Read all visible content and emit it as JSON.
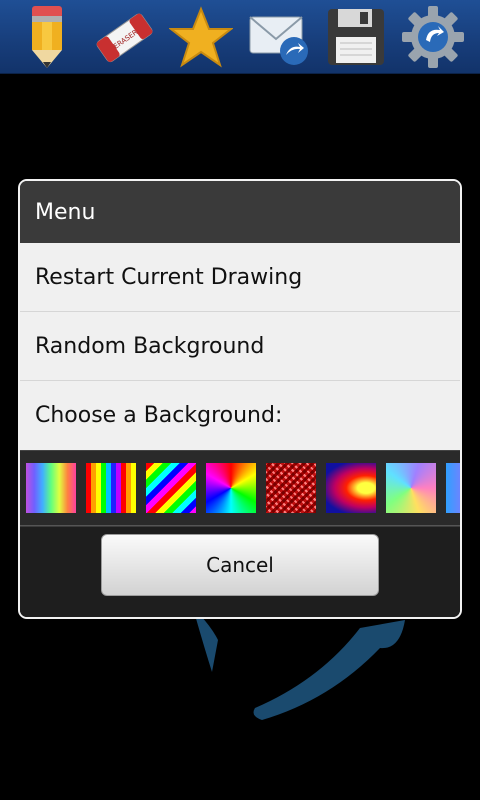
{
  "toolbar": {
    "items": [
      {
        "name": "pencil"
      },
      {
        "name": "eraser",
        "label": "ERASER"
      },
      {
        "name": "star"
      },
      {
        "name": "share-mail"
      },
      {
        "name": "save-floppy"
      },
      {
        "name": "settings-gear"
      }
    ]
  },
  "dialog": {
    "title": "Menu",
    "items": [
      {
        "label": "Restart Current Drawing"
      },
      {
        "label": "Random Background"
      },
      {
        "label": "Choose a Background:"
      }
    ],
    "backgrounds": [
      "rainbow-gradient",
      "rainbow-stripes",
      "diagonal-rainbow",
      "color-wheel",
      "red-pattern",
      "red-blue-swirl",
      "pastel-wheel",
      "partial-swatch"
    ],
    "cancel_label": "Cancel"
  },
  "colors": {
    "toolbar_bg": "#1a4585",
    "dialog_title_bg": "#3a3a3a",
    "menu_item_bg": "#f0f0f0",
    "canvas_bg": "#000000",
    "stroke": "#1a4a6e"
  }
}
